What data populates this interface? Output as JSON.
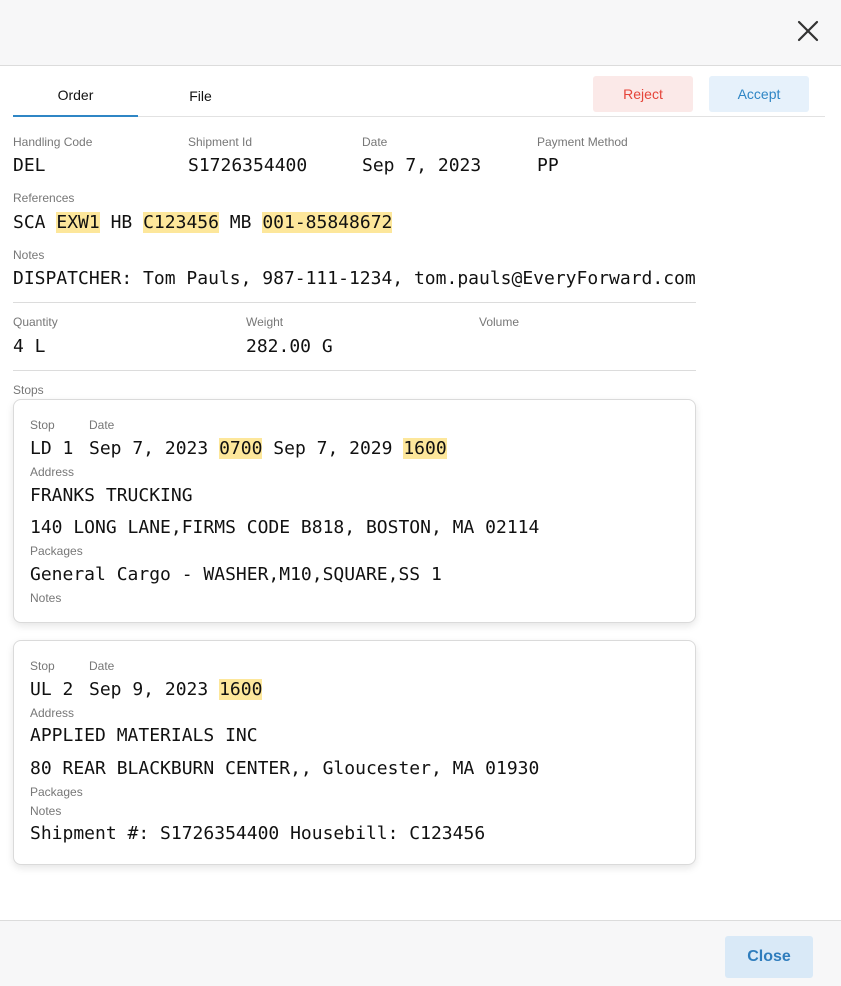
{
  "tabs": [
    {
      "label": "Order",
      "active": true
    },
    {
      "label": "File",
      "active": false
    }
  ],
  "actions": {
    "reject": "Reject",
    "accept": "Accept"
  },
  "order": {
    "handling_code": {
      "label": "Handling Code",
      "value": "DEL"
    },
    "shipment_id": {
      "label": "Shipment Id",
      "value": "S1726354400"
    },
    "date": {
      "label": "Date",
      "value": "Sep 7, 2023"
    },
    "payment_method": {
      "label": "Payment Method",
      "value": "PP"
    },
    "references": {
      "label": "References",
      "items": [
        {
          "type": "SCA",
          "value": "EXW1"
        },
        {
          "type": "HB",
          "value": "C123456"
        },
        {
          "type": "MB",
          "value": "001-85848672"
        }
      ]
    },
    "notes": {
      "label": "Notes",
      "value": "DISPATCHER: Tom Pauls, 987-111-1234, tom.pauls@EveryForward.com"
    },
    "quantity": {
      "label": "Quantity",
      "value": "4 L"
    },
    "weight": {
      "label": "Weight",
      "value": "282.00 G"
    },
    "volume": {
      "label": "Volume",
      "value": ""
    }
  },
  "stops_label": "Stops",
  "stops": [
    {
      "stop_label": "Stop",
      "date_label": "Date",
      "stop": "LD 1",
      "date_start": "Sep 7, 2023",
      "time_start": "0700",
      "date_end": "Sep 7, 2029",
      "time_end": "1600",
      "address_label": "Address",
      "address_name": "FRANKS TRUCKING",
      "address_line": "140 LONG LANE,FIRMS CODE B818, BOSTON, MA 02114",
      "packages_label": "Packages",
      "packages": "General Cargo - WASHER,M10,SQUARE,SS 1",
      "notes_label": "Notes",
      "notes": ""
    },
    {
      "stop_label": "Stop",
      "date_label": "Date",
      "stop": "UL 2",
      "date_start": "Sep 9, 2023",
      "time_start": "1600",
      "address_label": "Address",
      "address_name": "APPLIED MATERIALS INC",
      "address_line": "80 REAR BLACKBURN CENTER,, Gloucester, MA 01930",
      "packages_label": "Packages",
      "packages": "",
      "notes_label": "Notes",
      "notes": "Shipment #: S1726354400 Housebill: C123456"
    }
  ],
  "footer": {
    "close": "Close"
  },
  "colors": {
    "accent": "#2f86c5",
    "reject": "#e5453a",
    "highlight": "#fde79b"
  }
}
